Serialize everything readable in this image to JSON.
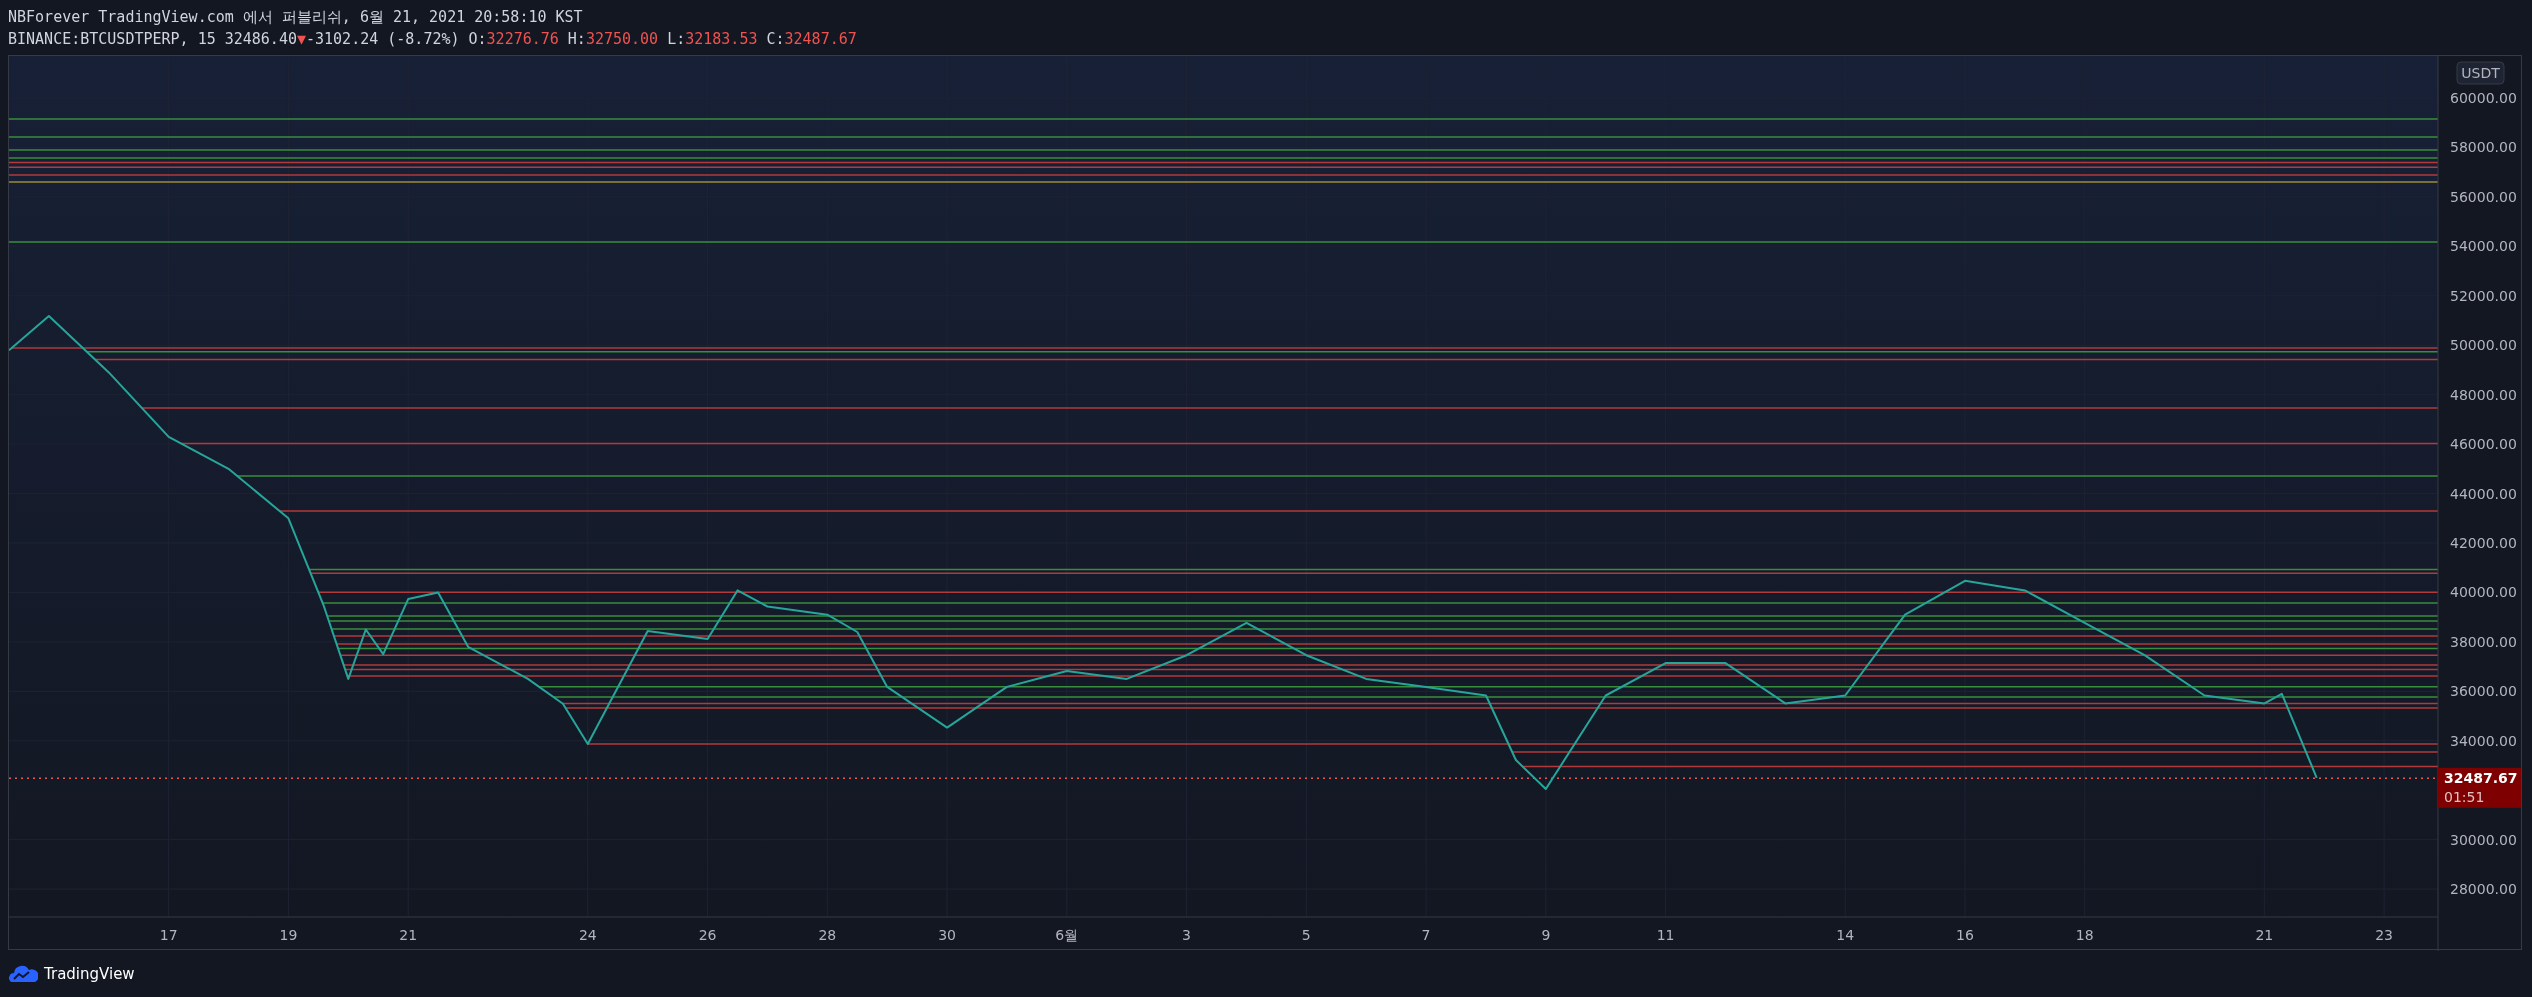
{
  "header": {
    "title": "NBForever TradingView.com 에서 퍼블리쉬, 6월 21, 2021 20:58:10 KST",
    "symbol": "BINANCE:BTCUSDTPERP, 15",
    "last": "32486.40",
    "arrow": "▼",
    "change": "-3102.24 (-8.72%)",
    "ohlc": [
      {
        "label": "O:",
        "value": "32276.76"
      },
      {
        "label": "H:",
        "value": "32750.00"
      },
      {
        "label": "L:",
        "value": "32183.53"
      },
      {
        "label": "C:",
        "value": "32487.67"
      }
    ]
  },
  "price_axis": {
    "currency": "USDT"
  },
  "price_tag": {
    "countdown": "01:51"
  },
  "chart_data": {
    "type": "line",
    "grid": true,
    "xlim": [
      "2021-05-14T08:00",
      "2021-06-23T21:36"
    ],
    "ylim": [
      26870,
      61700
    ],
    "x": [
      "2021-05-14T08:00",
      "2021-05-15T00:00",
      "2021-05-16T00:00",
      "2021-05-17T00:00",
      "2021-05-18T00:00",
      "2021-05-19T00:00",
      "2021-05-19T14:00",
      "2021-05-20T00:00",
      "2021-05-20T07:00",
      "2021-05-20T14:00",
      "2021-05-21T00:00",
      "2021-05-21T12:00",
      "2021-05-22T00:00",
      "2021-05-23T00:00",
      "2021-05-23T14:00",
      "2021-05-24T00:00",
      "2021-05-25T00:00",
      "2021-05-26T00:00",
      "2021-05-26T12:00",
      "2021-05-27T00:00",
      "2021-05-28T00:00",
      "2021-05-28T12:00",
      "2021-05-29T00:00",
      "2021-05-30T00:00",
      "2021-05-31T00:00",
      "2021-06-01T00:00",
      "2021-06-02T00:00",
      "2021-06-03T00:00",
      "2021-06-04T00:00",
      "2021-06-05T00:00",
      "2021-06-06T00:00",
      "2021-06-07T00:00",
      "2021-06-08T00:00",
      "2021-06-08T12:00",
      "2021-06-09T00:00",
      "2021-06-10T00:00",
      "2021-06-11T00:00",
      "2021-06-12T00:00",
      "2021-06-13T00:00",
      "2021-06-14T00:00",
      "2021-06-15T00:00",
      "2021-06-16T00:00",
      "2021-06-17T00:00",
      "2021-06-18T00:00",
      "2021-06-19T00:00",
      "2021-06-20T00:00",
      "2021-06-21T00:00",
      "2021-06-21T07:00",
      "2021-06-21T14:00",
      "2021-06-21T21:00"
    ],
    "series": [
      {
        "color": "#26a69a",
        "values": [
          49800,
          51180,
          48900,
          46290,
          45000,
          43000,
          39500,
          36500,
          38500,
          37500,
          39730,
          40000,
          37800,
          36500,
          35500,
          33870,
          38440,
          38110,
          40080,
          39430,
          39100,
          38400,
          36180,
          34530,
          36180,
          36820,
          36500,
          37460,
          38770,
          37460,
          36500,
          36180,
          35830,
          33220,
          32050,
          35830,
          37140,
          37140,
          35510,
          35830,
          39100,
          40470,
          40080,
          38770,
          37460,
          35830,
          35510,
          35900,
          34200,
          32500
        ]
      }
    ],
    "xticks": [
      {
        "value": "2021-05-17T00:00",
        "label": "17"
      },
      {
        "value": "2021-05-19T00:00",
        "label": "19"
      },
      {
        "value": "2021-05-21T00:00",
        "label": "21"
      },
      {
        "value": "2021-05-24T00:00",
        "label": "24"
      },
      {
        "value": "2021-05-26T00:00",
        "label": "26"
      },
      {
        "value": "2021-05-28T00:00",
        "label": "28"
      },
      {
        "value": "2021-05-30T00:00",
        "label": "30"
      },
      {
        "value": "2021-06-01T00:00",
        "label": "6월"
      },
      {
        "value": "2021-06-03T00:00",
        "label": "3"
      },
      {
        "value": "2021-06-05T00:00",
        "label": "5"
      },
      {
        "value": "2021-06-07T00:00",
        "label": "7"
      },
      {
        "value": "2021-06-09T00:00",
        "label": "9"
      },
      {
        "value": "2021-06-11T00:00",
        "label": "11"
      },
      {
        "value": "2021-06-14T00:00",
        "label": "14"
      },
      {
        "value": "2021-06-16T00:00",
        "label": "16"
      },
      {
        "value": "2021-06-18T00:00",
        "label": "18"
      },
      {
        "value": "2021-06-21T00:00",
        "label": "21"
      },
      {
        "value": "2021-06-23T00:00",
        "label": "23"
      }
    ],
    "yticks": [
      {
        "value": 60000,
        "label": "60000.00"
      },
      {
        "value": 58000,
        "label": "58000.00"
      },
      {
        "value": 56000,
        "label": "56000.00"
      },
      {
        "value": 54000,
        "label": "54000.00"
      },
      {
        "value": 52000,
        "label": "52000.00"
      },
      {
        "value": 50000,
        "label": "50000.00"
      },
      {
        "value": 48000,
        "label": "48000.00"
      },
      {
        "value": 46000,
        "label": "46000.00"
      },
      {
        "value": 44000,
        "label": "44000.00"
      },
      {
        "value": 42000,
        "label": "42000.00"
      },
      {
        "value": 40000,
        "label": "40000.00"
      },
      {
        "value": 38000,
        "label": "38000.00"
      },
      {
        "value": 36000,
        "label": "36000.00"
      },
      {
        "value": 34000,
        "label": "34000.00"
      },
      {
        "value": 30000,
        "label": "30000.00"
      },
      {
        "value": 28000,
        "label": "28000.00"
      }
    ],
    "ref_lines": [
      {
        "axis": "y",
        "value": 59150,
        "color": "#388e3c"
      },
      {
        "axis": "y",
        "value": 58420,
        "color": "#388e3c"
      },
      {
        "axis": "y",
        "value": 57900,
        "color": "#388e3c"
      },
      {
        "axis": "y",
        "value": 57570,
        "color": "#388e3c"
      },
      {
        "axis": "y",
        "value": 57390,
        "color": "#b23a3a"
      },
      {
        "axis": "y",
        "value": 57200,
        "color": "#b23a3a"
      },
      {
        "axis": "y",
        "value": 56890,
        "color": "#b23a3a"
      },
      {
        "axis": "y",
        "value": 56600,
        "color": "#9e8a3a"
      },
      {
        "axis": "y",
        "value": 54180,
        "color": "#388e3c"
      },
      {
        "axis": "y",
        "value": 49890,
        "color": "#b23a3a"
      },
      {
        "axis": "y",
        "value": 49740,
        "color": "#388e3c"
      },
      {
        "axis": "y",
        "value": 49420,
        "color": "#b23a3a"
      },
      {
        "axis": "y",
        "value": 47460,
        "color": "#b23a3a"
      },
      {
        "axis": "y",
        "value": 46020,
        "color": "#b23a3a"
      },
      {
        "axis": "y",
        "value": 44710,
        "color": "#388e3c"
      },
      {
        "axis": "y",
        "value": 43290,
        "color": "#b23a3a"
      },
      {
        "axis": "y",
        "value": 40930,
        "color": "#388e3c"
      },
      {
        "axis": "y",
        "value": 40780,
        "color": "#b23a3a"
      },
      {
        "axis": "y",
        "value": 40010,
        "color": "#b23a3a"
      },
      {
        "axis": "y",
        "value": 39570,
        "color": "#388e3c"
      },
      {
        "axis": "y",
        "value": 39050,
        "color": "#388e3c"
      },
      {
        "axis": "y",
        "value": 38840,
        "color": "#388e3c"
      },
      {
        "axis": "y",
        "value": 38520,
        "color": "#388e3c"
      },
      {
        "axis": "y",
        "value": 38240,
        "color": "#b23a3a"
      },
      {
        "axis": "y",
        "value": 37910,
        "color": "#b23a3a"
      },
      {
        "axis": "y",
        "value": 37730,
        "color": "#388e3c"
      },
      {
        "axis": "y",
        "value": 37460,
        "color": "#b23a3a"
      },
      {
        "axis": "y",
        "value": 37060,
        "color": "#b23a3a"
      },
      {
        "axis": "y",
        "value": 36880,
        "color": "#b23a3a"
      },
      {
        "axis": "y",
        "value": 36620,
        "color": "#b23a3a"
      },
      {
        "axis": "y",
        "value": 36180,
        "color": "#388e3c"
      },
      {
        "axis": "y",
        "value": 35770,
        "color": "#388e3c"
      },
      {
        "axis": "y",
        "value": 35510,
        "color": "#b23a3a"
      },
      {
        "axis": "y",
        "value": 35320,
        "color": "#b23a3a"
      },
      {
        "axis": "y",
        "value": 33870,
        "color": "#b23a3a"
      },
      {
        "axis": "y",
        "value": 33540,
        "color": "#b23a3a"
      },
      {
        "axis": "y",
        "value": 32960,
        "color": "#b23a3a"
      },
      {
        "axis": "y",
        "value": 32487.67,
        "color": "#ef5350",
        "label": "32487.67"
      }
    ]
  },
  "footer": {
    "brand": "TradingView"
  }
}
